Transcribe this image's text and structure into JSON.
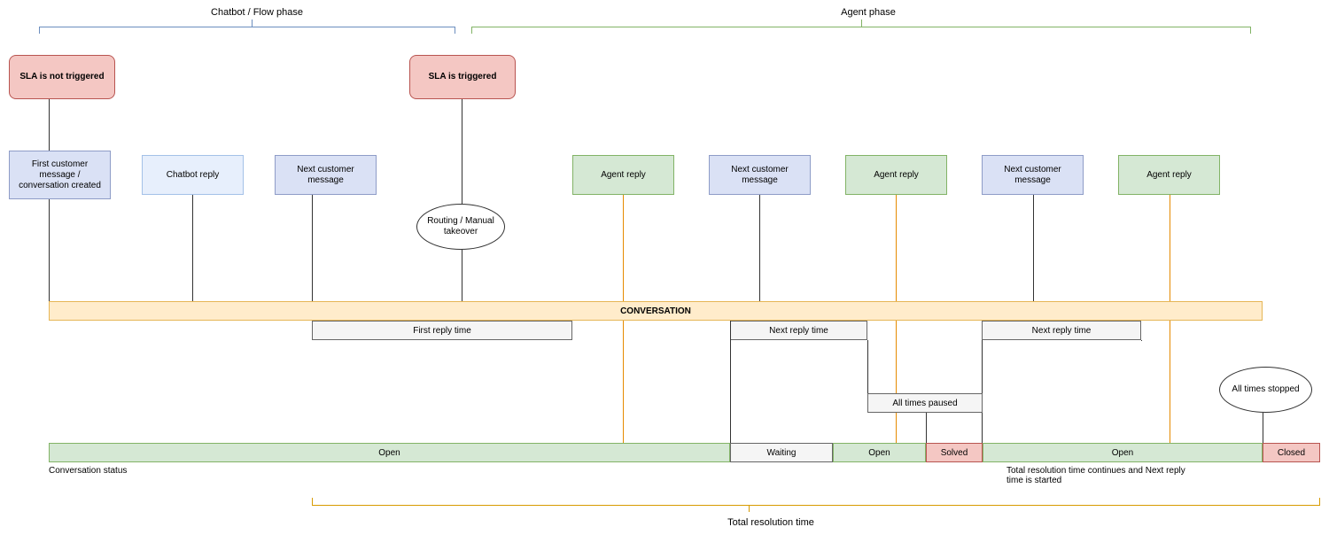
{
  "phases": {
    "chatbot": "Chatbot / Flow phase",
    "agent": "Agent phase"
  },
  "sla": {
    "not_triggered": "SLA is not triggered",
    "triggered": "SLA is triggered"
  },
  "events": {
    "first_customer": "First customer message / conversation created",
    "chatbot_reply": "Chatbot reply",
    "next_customer_1": "Next customer message",
    "routing": "Routing / Manual takeover",
    "agent_reply_1": "Agent reply",
    "next_customer_2": "Next customer message",
    "agent_reply_2": "Agent reply",
    "next_customer_3": "Next customer message",
    "agent_reply_3": "Agent reply"
  },
  "conversation": "CONVERSATION",
  "timings": {
    "first_reply": "First reply time",
    "next_reply_1": "Next reply time",
    "next_reply_2": "Next reply time",
    "all_paused": "All times paused",
    "all_stopped": "All times stopped"
  },
  "statuses": {
    "open_1": "Open",
    "waiting": "Waiting",
    "open_2": "Open",
    "solved": "Solved",
    "open_3": "Open",
    "closed": "Closed"
  },
  "labels": {
    "conv_status": "Conversation status",
    "resolution_note": "Total resolution time continues and Next reply time is started",
    "total_resolution": "Total resolution time"
  },
  "colors": {
    "brace_blue": "#6c8ebf",
    "brace_green": "#82b366",
    "brace_orange": "#d79b00"
  }
}
